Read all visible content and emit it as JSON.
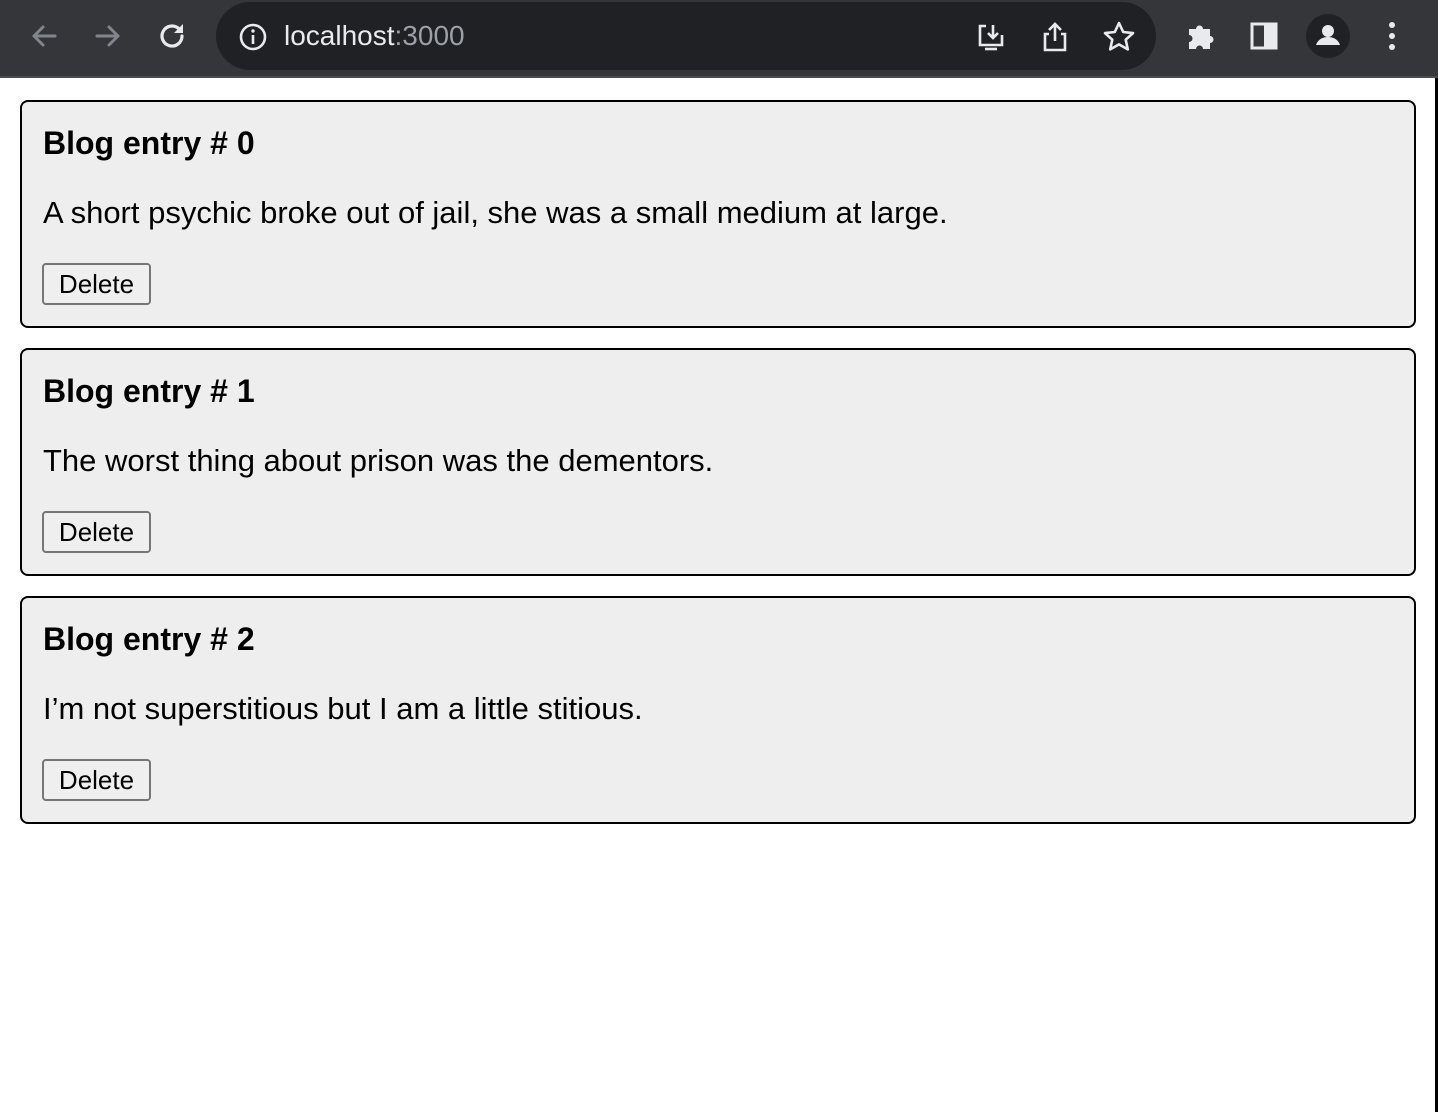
{
  "browser": {
    "url_host": "localhost",
    "url_port": ":3000",
    "icons": [
      "back-icon",
      "forward-icon",
      "reload-icon",
      "info-icon",
      "install-icon",
      "share-icon",
      "bookmark-star-icon",
      "extensions-icon",
      "side-panel-icon",
      "profile-icon",
      "menu-icon"
    ],
    "colors": {
      "toolbar": "#35363a",
      "omnibox": "#202124",
      "url_text": "#e8eaed",
      "port_text": "#9aa0a6"
    }
  },
  "posts": [
    {
      "title": "Blog entry # 0",
      "body": "A short psychic broke out of jail, she was a small medium at large.",
      "delete_label": "Delete"
    },
    {
      "title": "Blog entry # 1",
      "body": "The worst thing about prison was the dementors.",
      "delete_label": "Delete"
    },
    {
      "title": "Blog entry # 2",
      "body": "I’m not superstitious but I am a little stitious.",
      "delete_label": "Delete"
    }
  ],
  "colors": {
    "card_bg": "#eeeeee",
    "card_border": "#000000",
    "button_bg": "#efefef"
  }
}
